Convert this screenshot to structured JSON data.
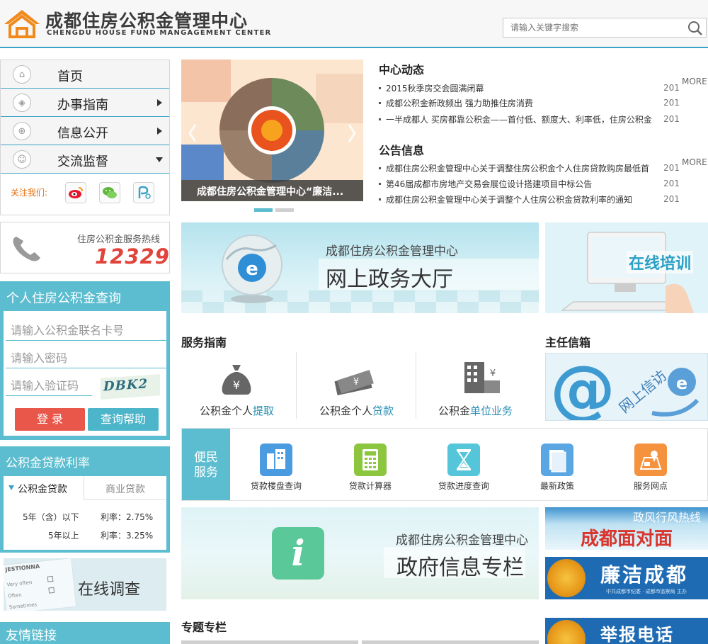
{
  "header": {
    "title_cn": "成都住房公积金管理中心",
    "title_en": "CHENGDU HOUSE FUND MANGAGEMENT CENTER",
    "search_placeholder": "请输入关键字搜索"
  },
  "nav": {
    "items": [
      {
        "label": "首页",
        "icon": "home-icon",
        "arrow": ""
      },
      {
        "label": "办事指南",
        "icon": "compass-icon",
        "arrow": "right"
      },
      {
        "label": "信息公开",
        "icon": "globe-icon",
        "arrow": "right"
      },
      {
        "label": "交流监督",
        "icon": "people-icon",
        "arrow": "down"
      }
    ],
    "follow_label": "关注我们:",
    "social": [
      "weibo-icon",
      "wechat-icon",
      "app-icon"
    ]
  },
  "hotline": {
    "label": "住房公积金服务热线",
    "number": "12329"
  },
  "query": {
    "title": "个人住房公积金查询",
    "card_placeholder": "请输入公积金联名卡号",
    "password_placeholder": "请输入密码",
    "captcha_placeholder": "请输入验证码",
    "captcha_text": "DBK2",
    "login_label": "登 录",
    "help_label": "查询帮助"
  },
  "loan": {
    "title": "公积金贷款利率",
    "tab_active": "公积金贷款",
    "tab_inactive": "商业贷款",
    "rows": [
      {
        "term": "5年（含）以下",
        "rate": "利率：2.75%"
      },
      {
        "term": "5年以上",
        "rate": "利率：3.25%"
      }
    ]
  },
  "survey": {
    "label": "在线调查",
    "paper_lines": [
      "JESTIONNA",
      "Very often",
      "Often",
      "Sometimes"
    ]
  },
  "links": {
    "title": "友情链接"
  },
  "slide": {
    "caption": "成都住房公积金管理中心“廉洁..."
  },
  "news": {
    "title": "中心动态",
    "more": "MORE",
    "items": [
      {
        "text": "2015秋季房交会圆满闭幕",
        "date": "201"
      },
      {
        "text": "成都公积金新政频出 强力助推住房消费",
        "date": "201"
      },
      {
        "text": "一半成都人 买房都靠公积金——首付低、额度大、利率低，住房公积金",
        "date": "201"
      }
    ]
  },
  "notice": {
    "title": "公告信息",
    "more": "MORE",
    "items": [
      {
        "text": "成都住房公积金管理中心关于调整住房公积金个人住房贷款购房最低首",
        "date": "201"
      },
      {
        "text": "第46届成都市房地产交易会展位设计搭建项目中标公告",
        "date": "201"
      },
      {
        "text": "成都住房公积金管理中心关于调整个人住房公积金贷款利率的通知",
        "date": "201"
      }
    ]
  },
  "banner_e": {
    "line1": "成都住房公积金管理中心",
    "line2": "网上政务大厅"
  },
  "banner_train": {
    "label": "在线培训"
  },
  "service": {
    "title": "服务指南",
    "items": [
      {
        "prefix": "公积金个人",
        "highlight": "提取",
        "icon": "money-bag-icon"
      },
      {
        "prefix": "公积金个人",
        "highlight": "贷款",
        "icon": "cash-stack-icon"
      },
      {
        "prefix": "公积金",
        "highlight": "单位业务",
        "icon": "building-icon"
      }
    ]
  },
  "mailbox": {
    "title": "主任信箱",
    "label": "网上信访"
  },
  "convenience": {
    "title_l1": "便民",
    "title_l2": "服务",
    "items": [
      {
        "label": "贷款楼盘查询",
        "icon": "building-search-icon",
        "color": "#4a9be0"
      },
      {
        "label": "贷款计算器",
        "icon": "calculator-icon",
        "color": "#8cc63f"
      },
      {
        "label": "贷款进度查询",
        "icon": "hourglass-icon",
        "color": "#55c6d9"
      },
      {
        "label": "最新政策",
        "icon": "document-icon",
        "color": "#5aa6e3"
      },
      {
        "label": "服务网点",
        "icon": "map-pin-icon",
        "color": "#f5923e"
      }
    ]
  },
  "gov": {
    "line1": "成都住房公积金管理中心",
    "line2": "政府信息专栏"
  },
  "hotline_banner": {
    "line1": "政风行风热线",
    "line2": "成都面对面"
  },
  "clean_banner": {
    "label": "廉洁成都",
    "sub": "中共成都市纪委 · 成都市监察局  主办"
  },
  "report_banner": {
    "label": "举报电话"
  },
  "special": {
    "title": "专题专栏"
  }
}
